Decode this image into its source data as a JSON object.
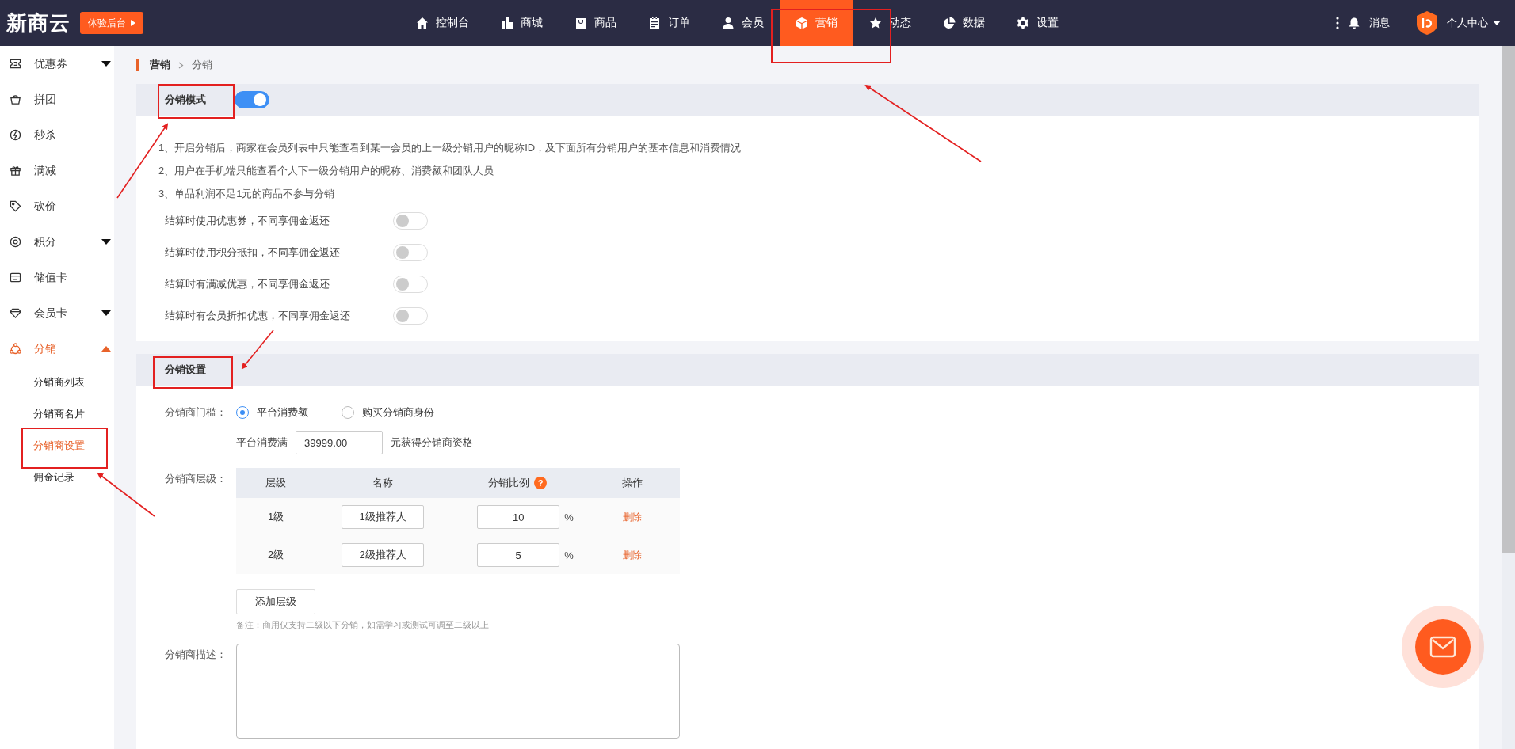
{
  "brand": {
    "logo": "新商云",
    "trial_button": "体验后台"
  },
  "nav": [
    {
      "label": "控制台",
      "selected": false
    },
    {
      "label": "商城",
      "selected": false
    },
    {
      "label": "商品",
      "selected": false
    },
    {
      "label": "订单",
      "selected": false
    },
    {
      "label": "会员",
      "selected": false
    },
    {
      "label": "营销",
      "selected": true
    },
    {
      "label": "动态",
      "selected": false
    },
    {
      "label": "数据",
      "selected": false
    },
    {
      "label": "设置",
      "selected": false
    }
  ],
  "header_right": {
    "messages": "消息",
    "user_menu": "个人中心"
  },
  "sidebar": {
    "items": [
      {
        "label": "优惠券",
        "kind": "group",
        "expanded": false,
        "selected": false
      },
      {
        "label": "拼团",
        "kind": "link",
        "selected": false
      },
      {
        "label": "秒杀",
        "kind": "link",
        "selected": false
      },
      {
        "label": "满减",
        "kind": "link",
        "selected": false
      },
      {
        "label": "砍价",
        "kind": "link",
        "selected": false
      },
      {
        "label": "积分",
        "kind": "group",
        "expanded": false,
        "selected": false
      },
      {
        "label": "储值卡",
        "kind": "link",
        "selected": false
      },
      {
        "label": "会员卡",
        "kind": "group",
        "expanded": false,
        "selected": false
      },
      {
        "label": "分销",
        "kind": "group",
        "expanded": true,
        "selected": true,
        "children": [
          {
            "label": "分销商列表",
            "selected": false
          },
          {
            "label": "分销商名片",
            "selected": false
          },
          {
            "label": "分销商设置",
            "selected": true
          },
          {
            "label": "佣金记录",
            "selected": false
          }
        ]
      }
    ]
  },
  "breadcrumb": [
    "营销",
    "分销"
  ],
  "mode_section": {
    "title": "分销模式",
    "on": true,
    "notes": [
      "1、开启分销后，商家在会员列表中只能查看到某一会员的上一级分销用户的昵称ID，及下面所有分销用户的基本信息和消费情况",
      "2、用户在手机端只能查看个人下一级分销用户的昵称、消费额和团队人员",
      "3、单品利润不足1元的商品不参与分销"
    ],
    "options": [
      {
        "label": "结算时使用优惠券，不同享佣金返还",
        "on": false
      },
      {
        "label": "结算时使用积分抵扣，不同享佣金返还",
        "on": false
      },
      {
        "label": "结算时有满减优惠，不同享佣金返还",
        "on": false
      },
      {
        "label": "结算时有会员折扣优惠，不同享佣金返还",
        "on": false
      }
    ]
  },
  "settings_section": {
    "title": "分销设置",
    "threshold": {
      "label": "分销商门槛：",
      "options": [
        {
          "label": "平台消费额",
          "selected": true
        },
        {
          "label": "购买分销商身份",
          "selected": false
        }
      ],
      "prefix": "平台消费满",
      "value": "39999.00",
      "suffix": "元获得分销商资格"
    },
    "levels": {
      "label": "分销商层级：",
      "columns": [
        {
          "label": "层级"
        },
        {
          "label": "名称"
        },
        {
          "label": "分销比例",
          "help": "?"
        },
        {
          "label": "操作"
        }
      ],
      "rows": [
        {
          "level": "1级",
          "name": "1级推荐人",
          "ratio": "10",
          "unit": "%",
          "action": "删除"
        },
        {
          "level": "2级",
          "name": "2级推荐人",
          "ratio": "5",
          "unit": "%",
          "action": "删除"
        }
      ]
    },
    "add_button": "添加层级",
    "note": "备注：商用仅支持二级以下分销，如需学习或测试可调至二级以上",
    "description": {
      "label": "分销商描述："
    }
  }
}
